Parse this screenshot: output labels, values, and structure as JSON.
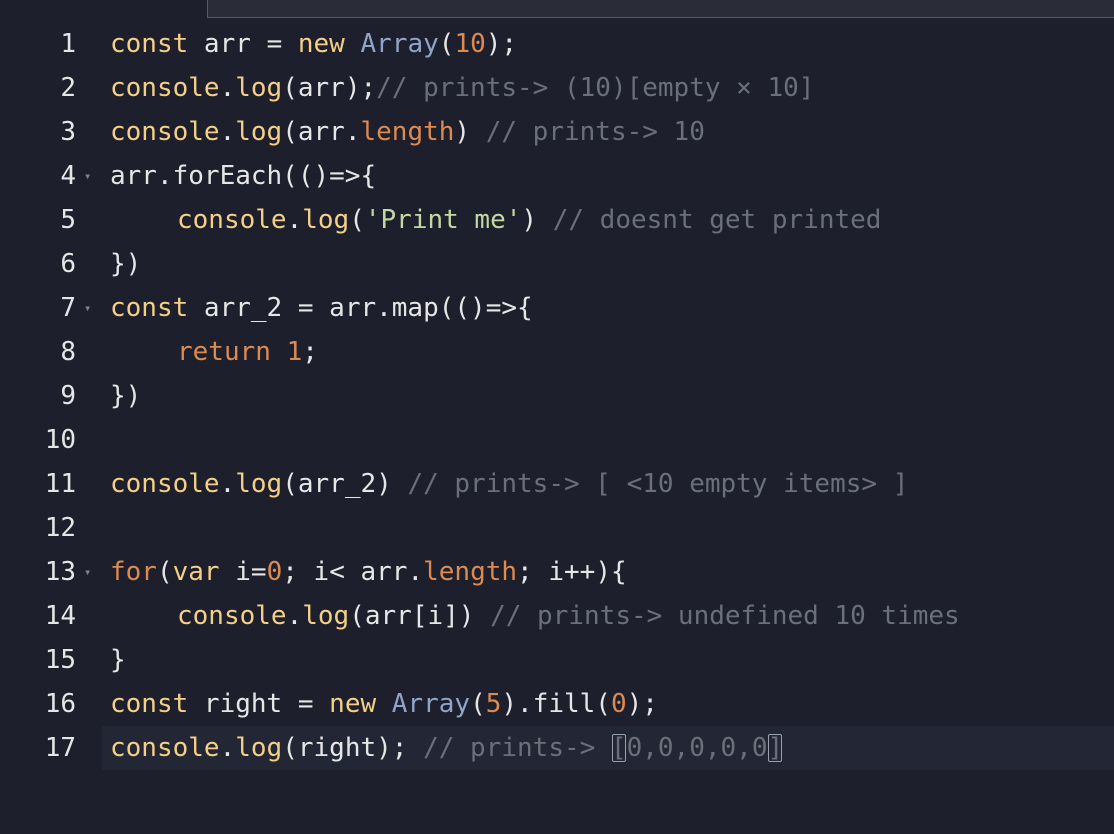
{
  "editor": {
    "lines": [
      {
        "n": "1",
        "fold": false,
        "indent": 0,
        "tokens": [
          {
            "t": "const",
            "c": "kw"
          },
          {
            "t": " arr ",
            "c": "plain"
          },
          {
            "t": "=",
            "c": "op"
          },
          {
            "t": " ",
            "c": "plain"
          },
          {
            "t": "new",
            "c": "kw"
          },
          {
            "t": " ",
            "c": "plain"
          },
          {
            "t": "Array",
            "c": "ty"
          },
          {
            "t": "(",
            "c": "plain"
          },
          {
            "t": "10",
            "c": "num"
          },
          {
            "t": ");",
            "c": "plain"
          }
        ]
      },
      {
        "n": "2",
        "fold": false,
        "indent": 0,
        "tokens": [
          {
            "t": "console",
            "c": "fn"
          },
          {
            "t": ".",
            "c": "plain"
          },
          {
            "t": "log",
            "c": "fn"
          },
          {
            "t": "(arr);",
            "c": "plain"
          },
          {
            "t": "// prints-> (10)[empty × 10]",
            "c": "cm"
          }
        ]
      },
      {
        "n": "3",
        "fold": false,
        "indent": 0,
        "tokens": [
          {
            "t": "console",
            "c": "fn"
          },
          {
            "t": ".",
            "c": "plain"
          },
          {
            "t": "log",
            "c": "fn"
          },
          {
            "t": "(arr.",
            "c": "plain"
          },
          {
            "t": "length",
            "c": "prop"
          },
          {
            "t": ") ",
            "c": "plain"
          },
          {
            "t": "// prints-> 10",
            "c": "cm"
          }
        ]
      },
      {
        "n": "4",
        "fold": true,
        "indent": 0,
        "tokens": [
          {
            "t": "arr.forEach(()",
            "c": "plain"
          },
          {
            "t": "=>",
            "c": "op"
          },
          {
            "t": "{",
            "c": "plain"
          }
        ]
      },
      {
        "n": "5",
        "fold": false,
        "indent": 1,
        "tokens": [
          {
            "t": "console",
            "c": "fn"
          },
          {
            "t": ".",
            "c": "plain"
          },
          {
            "t": "log",
            "c": "fn"
          },
          {
            "t": "(",
            "c": "plain"
          },
          {
            "t": "'Print me'",
            "c": "str"
          },
          {
            "t": ") ",
            "c": "plain"
          },
          {
            "t": "// doesnt get printed",
            "c": "cm"
          }
        ]
      },
      {
        "n": "6",
        "fold": false,
        "indent": 0,
        "tokens": [
          {
            "t": "})",
            "c": "plain"
          }
        ]
      },
      {
        "n": "7",
        "fold": true,
        "indent": 0,
        "tokens": [
          {
            "t": "const",
            "c": "kw"
          },
          {
            "t": " arr_2 ",
            "c": "plain"
          },
          {
            "t": "=",
            "c": "op"
          },
          {
            "t": " arr.map(()",
            "c": "plain"
          },
          {
            "t": "=>",
            "c": "op"
          },
          {
            "t": "{",
            "c": "plain"
          }
        ]
      },
      {
        "n": "8",
        "fold": false,
        "indent": 1,
        "tokens": [
          {
            "t": "return",
            "c": "prop"
          },
          {
            "t": " ",
            "c": "plain"
          },
          {
            "t": "1",
            "c": "num"
          },
          {
            "t": ";",
            "c": "plain"
          }
        ]
      },
      {
        "n": "9",
        "fold": false,
        "indent": 0,
        "tokens": [
          {
            "t": "})",
            "c": "plain"
          }
        ]
      },
      {
        "n": "10",
        "fold": false,
        "indent": 0,
        "tokens": []
      },
      {
        "n": "11",
        "fold": false,
        "indent": 0,
        "tokens": [
          {
            "t": "console",
            "c": "fn"
          },
          {
            "t": ".",
            "c": "plain"
          },
          {
            "t": "log",
            "c": "fn"
          },
          {
            "t": "(arr_2) ",
            "c": "plain"
          },
          {
            "t": "// prints-> [ <10 empty items> ]",
            "c": "cm"
          }
        ]
      },
      {
        "n": "12",
        "fold": false,
        "indent": 0,
        "tokens": []
      },
      {
        "n": "13",
        "fold": true,
        "indent": 0,
        "tokens": [
          {
            "t": "for",
            "c": "prop"
          },
          {
            "t": "(",
            "c": "plain"
          },
          {
            "t": "var",
            "c": "kw"
          },
          {
            "t": " i",
            "c": "plain"
          },
          {
            "t": "=",
            "c": "op"
          },
          {
            "t": "0",
            "c": "num"
          },
          {
            "t": "; i",
            "c": "plain"
          },
          {
            "t": "<",
            "c": "op"
          },
          {
            "t": " arr.",
            "c": "plain"
          },
          {
            "t": "length",
            "c": "prop"
          },
          {
            "t": "; i",
            "c": "plain"
          },
          {
            "t": "++",
            "c": "op"
          },
          {
            "t": "){",
            "c": "plain"
          }
        ]
      },
      {
        "n": "14",
        "fold": false,
        "indent": 1,
        "tokens": [
          {
            "t": "console",
            "c": "fn"
          },
          {
            "t": ".",
            "c": "plain"
          },
          {
            "t": "log",
            "c": "fn"
          },
          {
            "t": "(arr[i]) ",
            "c": "plain"
          },
          {
            "t": "// prints-> undefined 10 times",
            "c": "cm"
          }
        ]
      },
      {
        "n": "15",
        "fold": false,
        "indent": 0,
        "tokens": [
          {
            "t": "}",
            "c": "plain"
          }
        ]
      },
      {
        "n": "16",
        "fold": false,
        "indent": 0,
        "tokens": [
          {
            "t": "const",
            "c": "kw"
          },
          {
            "t": " right ",
            "c": "plain"
          },
          {
            "t": "=",
            "c": "op"
          },
          {
            "t": " ",
            "c": "plain"
          },
          {
            "t": "new",
            "c": "kw"
          },
          {
            "t": " ",
            "c": "plain"
          },
          {
            "t": "Array",
            "c": "ty"
          },
          {
            "t": "(",
            "c": "plain"
          },
          {
            "t": "5",
            "c": "num"
          },
          {
            "t": ").fill(",
            "c": "plain"
          },
          {
            "t": "0",
            "c": "num"
          },
          {
            "t": ");",
            "c": "plain"
          }
        ]
      },
      {
        "n": "17",
        "fold": false,
        "indent": 0,
        "active": true,
        "tokens": [
          {
            "t": "console",
            "c": "fn"
          },
          {
            "t": ".",
            "c": "plain"
          },
          {
            "t": "log",
            "c": "fn"
          },
          {
            "t": "(right); ",
            "c": "plain"
          },
          {
            "t": "// prints-> ",
            "c": "cm"
          },
          {
            "t": "[",
            "c": "cm",
            "box": true
          },
          {
            "t": "0,0,0,0,0",
            "c": "cm"
          },
          {
            "t": "]",
            "c": "cm",
            "box": true
          }
        ]
      }
    ],
    "fold_glyph": "▾"
  }
}
